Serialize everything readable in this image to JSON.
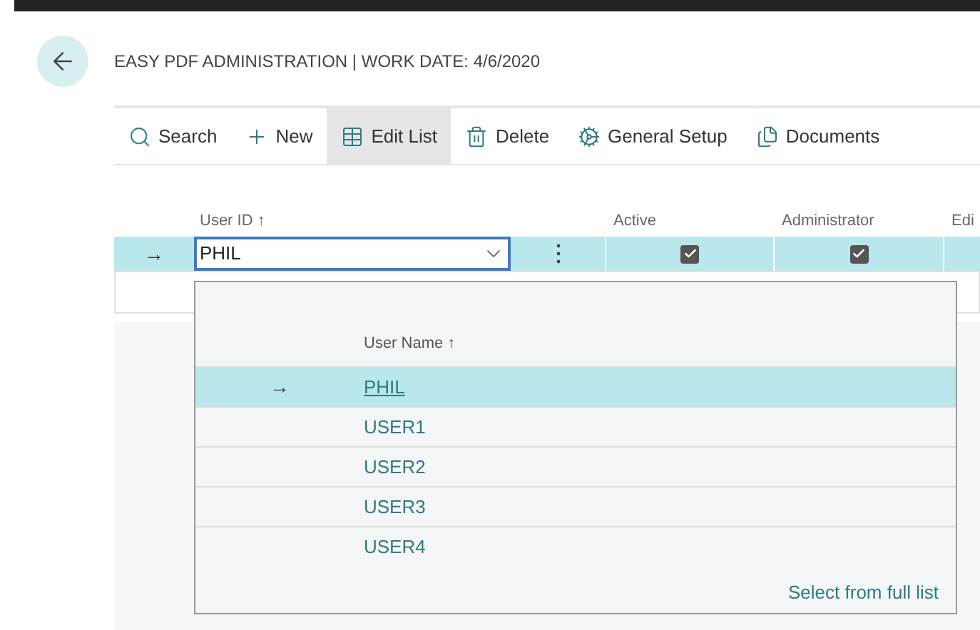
{
  "page": {
    "title": "EASY PDF ADMINISTRATION | WORK DATE: 4/6/2020"
  },
  "actions": [
    {
      "label": "Search",
      "kind": "search",
      "selected": false
    },
    {
      "label": "New",
      "kind": "new",
      "selected": false
    },
    {
      "label": "Edit List",
      "kind": "edit",
      "selected": true
    },
    {
      "label": "Delete",
      "kind": "delete",
      "selected": false
    },
    {
      "label": "General Setup",
      "kind": "setup",
      "selected": false
    },
    {
      "label": "Documents",
      "kind": "documents",
      "selected": false
    }
  ],
  "table": {
    "columns": [
      "User ID ↑",
      "Active",
      "Administrator",
      "Edi"
    ],
    "rows": [
      {
        "marker": "→",
        "user_id": "PHIL",
        "active": true,
        "administrator": true
      }
    ]
  },
  "lookup": {
    "column": "User Name ↑",
    "items": [
      {
        "marker": "→",
        "name": "PHIL",
        "selected": true
      },
      {
        "name": "USER1",
        "selected": false
      },
      {
        "name": "USER2",
        "selected": false
      },
      {
        "name": "USER3",
        "selected": false
      },
      {
        "name": "USER4",
        "selected": false
      }
    ],
    "footer_link": "Select from full list"
  }
}
